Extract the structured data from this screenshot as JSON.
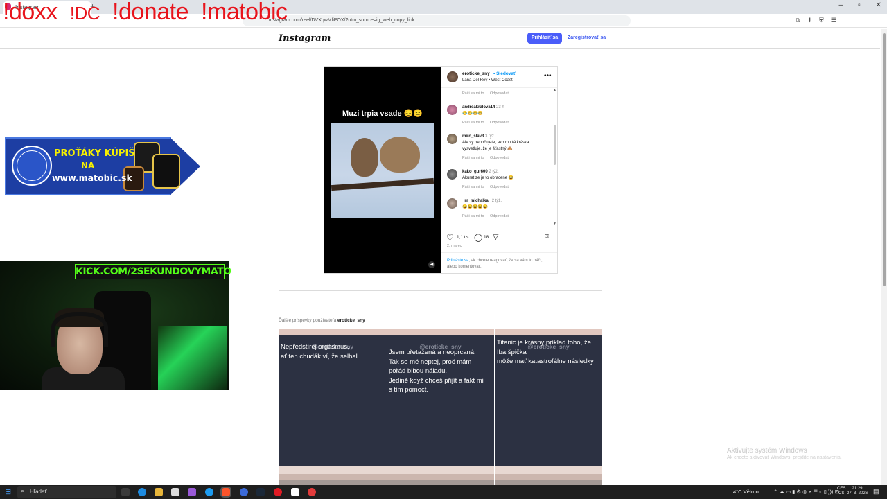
{
  "browser": {
    "tab_title": "Instagram",
    "url": "instagram.com/reel/DVXqwMliPOX/?utm_source=ig_web_copy_link",
    "window_controls": [
      "–",
      "▫",
      "✕"
    ]
  },
  "overlay": {
    "commands": [
      "!doxx",
      "!DC",
      "!donate",
      "!matobic"
    ]
  },
  "ig": {
    "logo": "Instagram",
    "login_label": "Prihlásiť sa",
    "register_label": "Zaregistrovať sa",
    "post": {
      "video_caption": "Muzi trpia vsade 😔😑",
      "owner": "eroticke_sny",
      "follow": "• Sledovať",
      "audio": "Lana Del Rey • West Coast",
      "comments": [
        {
          "user": "",
          "time": "",
          "text": "",
          "like": "Páči sa mi to",
          "reply": "Odpovedať"
        },
        {
          "user": "andreakralova14",
          "time": "23 h",
          "text": "😂😂😂😂",
          "like": "Páči sa mi to",
          "reply": "Odpovedať"
        },
        {
          "user": "miro_slav3",
          "time": "3 týž.",
          "text": "Ale vy nepočujete, ako mu tá kráska vysvetluje, že je šťastný 🙈",
          "like": "Páči sa mi to",
          "reply": "Odpovedať"
        },
        {
          "user": "kako_gur600",
          "time": "2 týž.",
          "text": "Akurat ze je to obracene 😂",
          "like": "Páči sa mi to",
          "reply": "Odpovedať"
        },
        {
          "user": "_m_michalka_",
          "time": "2 týž.",
          "text": "😂😂😂😂😂",
          "like": "Páči sa mi to",
          "reply": "Odpovedať"
        }
      ],
      "likes": "1,1 tis.",
      "comment_count": "18",
      "date": "2. marec",
      "login_prompt_link": "Prihláste sa",
      "login_prompt_rest": ", ak chcete reagovať, že sa vám to páči, alebo komentovať."
    },
    "more_posts_prefix": "Ďalšie príspevky používateľa ",
    "more_posts_user": "eroticke_sny",
    "grid": [
      {
        "handle": "@eroticke_sny",
        "lines": [
          "",
          "",
          "",
          "",
          "Nepředstírej orgasmus,",
          "",
          "ať ten chudák ví, že selhal."
        ]
      },
      {
        "handle": "@eroticke_sny",
        "lines": [
          "",
          "",
          "Jsem přetažená a neoprcaná.",
          "",
          "Tak se mě neptej, proč mám",
          "pořád blbou náladu.",
          "",
          "Jedině když chceš přijít a fakt mi",
          "s tím pomoct."
        ]
      },
      {
        "handle": "@eroticke_sny",
        "lines": [
          "",
          "",
          "",
          "",
          "Titanic je krásny príklad toho, že",
          "",
          "Iba špička",
          "",
          "môže mať katastrofálne následky"
        ]
      }
    ]
  },
  "banner": {
    "line1": "PROŤÁKY KÚPIŠ",
    "line2": "NA",
    "line3": "www.matobic.sk"
  },
  "webcam": {
    "kick_label": "KICK.COM/2SEKUNDOVYMATO"
  },
  "windows": {
    "activate_title": "Aktivujte systém Windows",
    "activate_sub": "Ak chcete aktivovať Windows, prejdite na nastavenia.",
    "search_placeholder": "Hľadať",
    "weather": "4°C  Větrno",
    "lang_top": "CES",
    "lang_bottom": "CS",
    "time": "21:29",
    "date": "27. 3. 2026"
  }
}
